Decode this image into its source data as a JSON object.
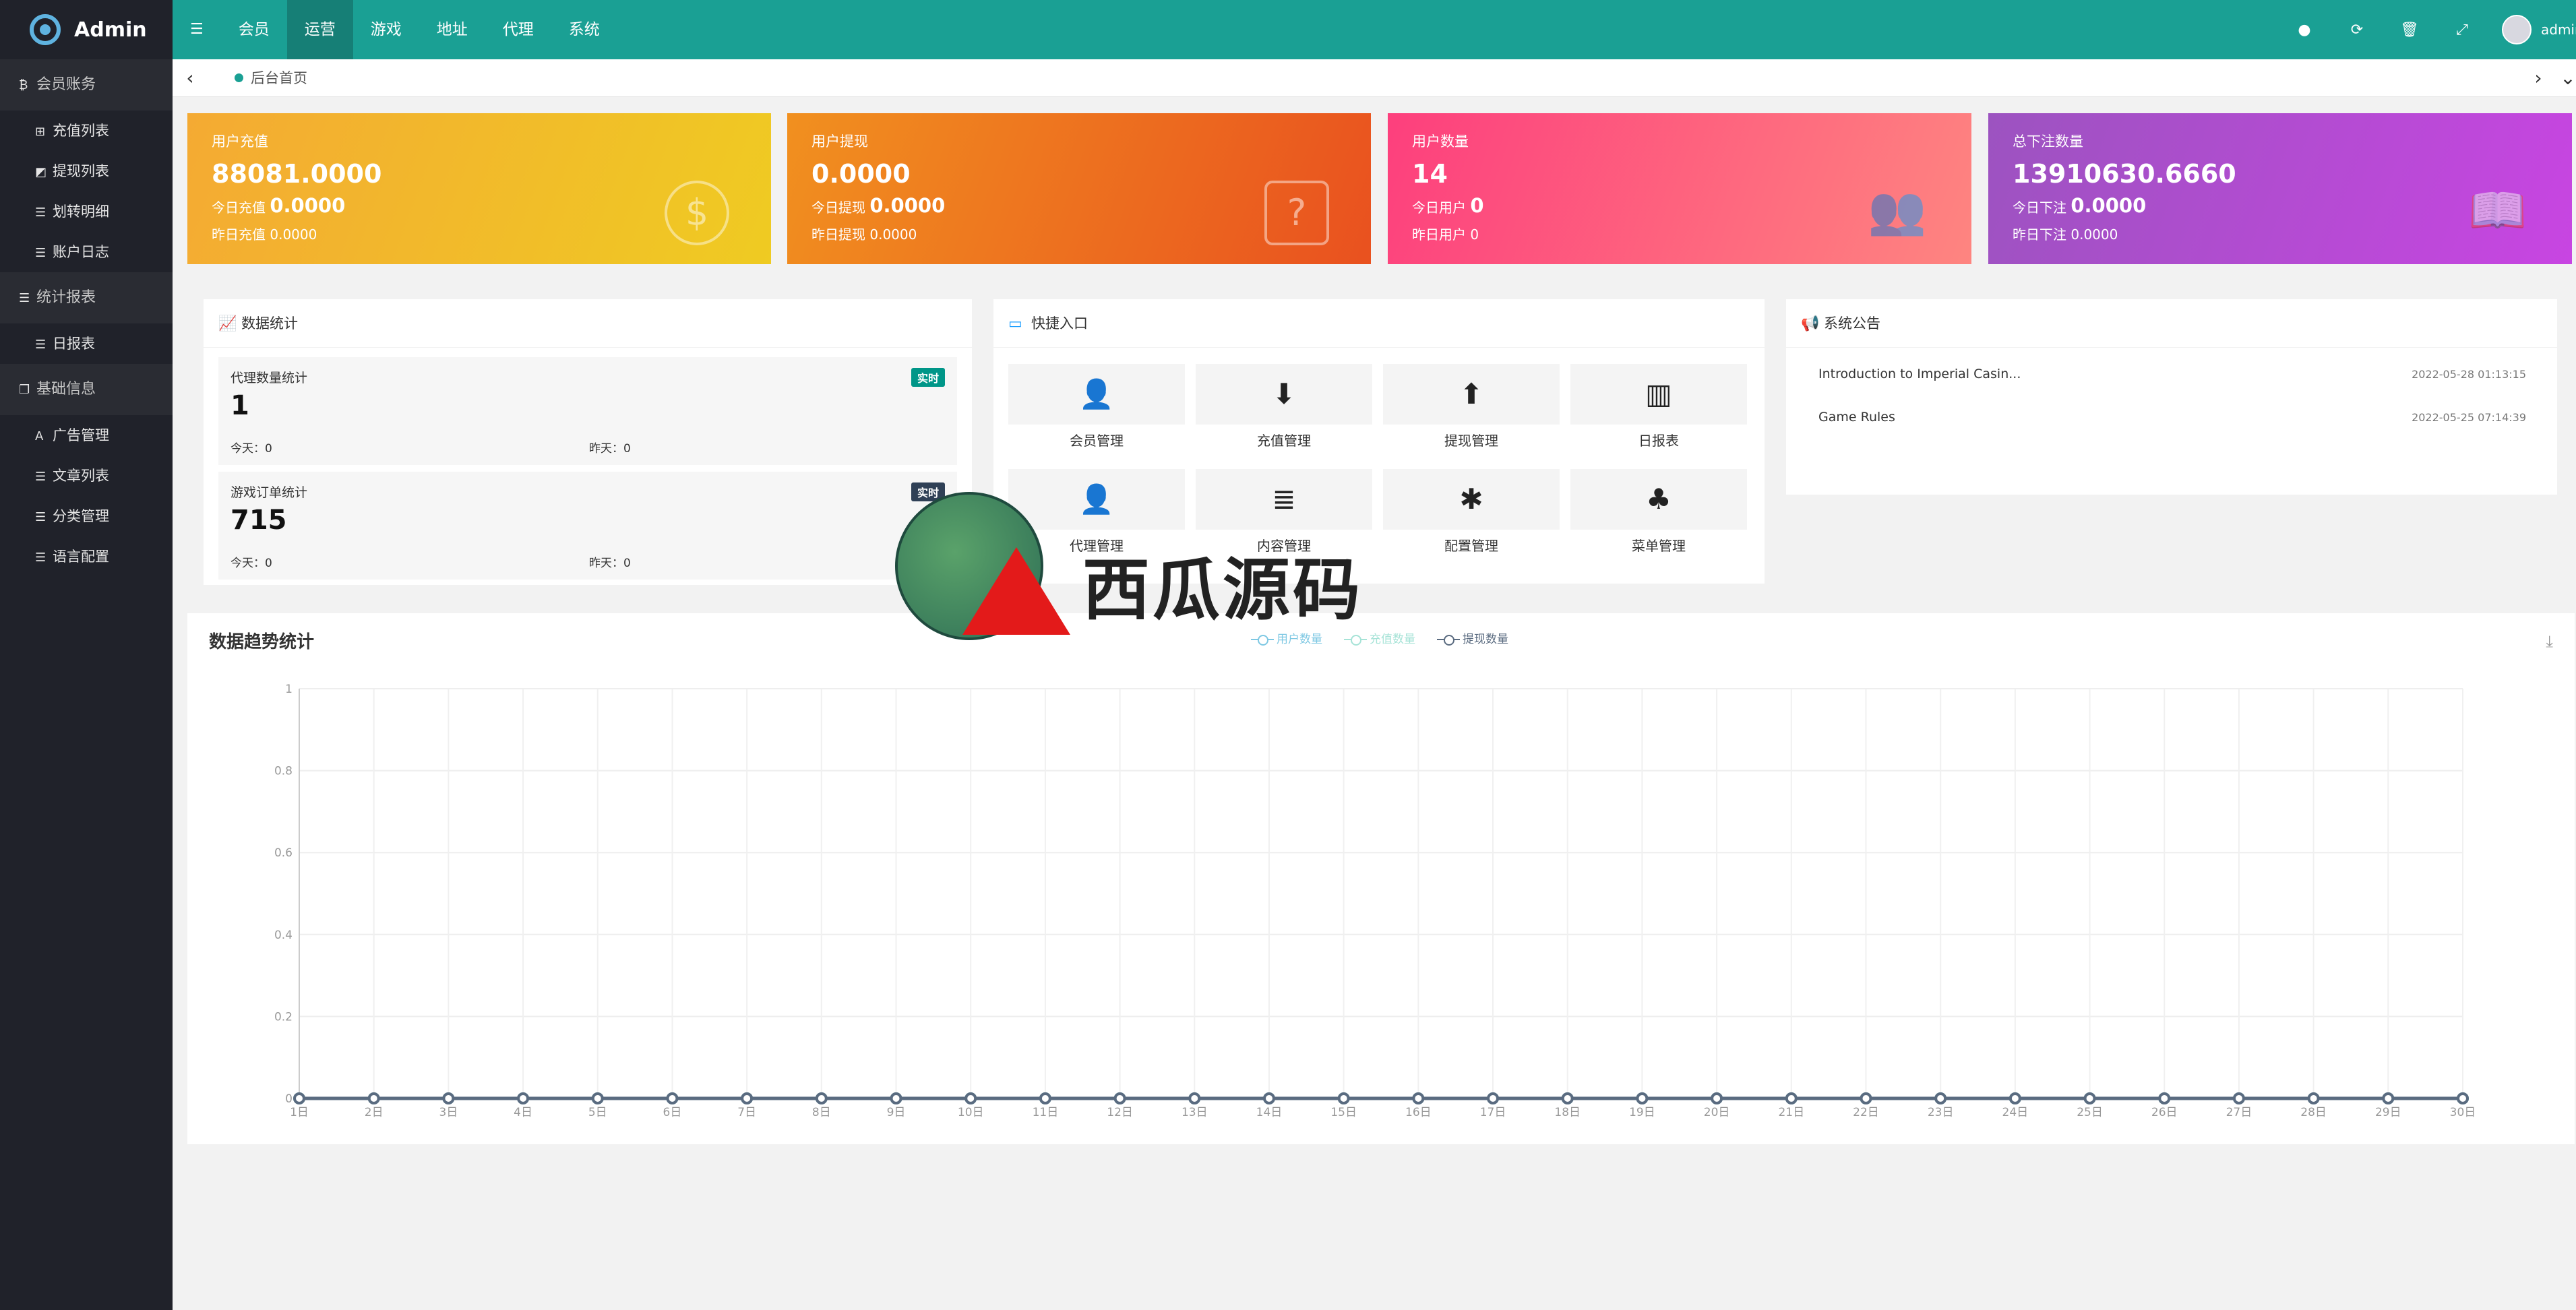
{
  "app": {
    "logo_text": "Admin"
  },
  "top_menu": [
    {
      "icon": "menu-icon",
      "label": "☰"
    },
    {
      "label": "会员"
    },
    {
      "label": "运营",
      "active": true
    },
    {
      "label": "游戏"
    },
    {
      "label": "地址"
    },
    {
      "label": "代理"
    },
    {
      "label": "系统"
    }
  ],
  "top_right": {
    "icons": [
      "settings-icon",
      "refresh-icon",
      "trash-icon",
      "fullscreen-icon"
    ],
    "user": "admin"
  },
  "sidebar": {
    "groups": [
      {
        "label": "会员账务",
        "icon": "bitcoin-icon",
        "items": [
          "充值列表",
          "提现列表",
          "划转明细",
          "账户日志"
        ]
      },
      {
        "label": "统计报表",
        "icon": "list-icon",
        "items": [
          "日报表"
        ]
      },
      {
        "label": "基础信息",
        "icon": "copy-icon",
        "items": [
          "广告管理",
          "文章列表",
          "分类管理",
          "语言配置"
        ]
      }
    ]
  },
  "tabbar": {
    "current_tab": "后台首页",
    "prev": "‹",
    "next": "›",
    "more": "⌄"
  },
  "cards": [
    {
      "title": "用户充值",
      "value": "88081.0000",
      "today_label": "今日充值",
      "today_value": "0.0000",
      "yesterday": "昨日充值 0.0000",
      "icon": "dollar-icon",
      "glyph": "$"
    },
    {
      "title": "用户提现",
      "value": "0.0000",
      "today_label": "今日提现",
      "today_value": "0.0000",
      "yesterday": "昨日提现 0.0000",
      "icon": "question-edit-icon",
      "glyph": "?"
    },
    {
      "title": "用户数量",
      "value": "14",
      "today_label": "今日用户",
      "today_value": "0",
      "yesterday": "昨日用户 0",
      "icon": "users-icon",
      "glyph": "👥"
    },
    {
      "title": "总下注数量",
      "value": "13910630.6660",
      "today_label": "今日下注",
      "today_value": "0.0000",
      "yesterday": "昨日下注 0.0000",
      "icon": "book-icon",
      "glyph": "📖"
    }
  ],
  "data_stats": {
    "title": "数据统计",
    "items": [
      {
        "label": "代理数量统计",
        "value": "1",
        "today": "今天：0",
        "yesterday": "昨天：0",
        "badge": "实时",
        "badge_color": "#009688"
      },
      {
        "label": "游戏订单统计",
        "value": "715",
        "today": "今天：0",
        "yesterday": "昨天：0",
        "badge": "实时",
        "badge_color": "#2f4056"
      }
    ]
  },
  "quick_entry": {
    "title": "快捷入口",
    "items": [
      {
        "label": "会员管理",
        "icon": "user-icon",
        "glyph": "👤"
      },
      {
        "label": "充值管理",
        "icon": "arrow-down-circle-icon",
        "glyph": "⬇"
      },
      {
        "label": "提现管理",
        "icon": "arrow-up-circle-icon",
        "glyph": "⬆"
      },
      {
        "label": "日报表",
        "icon": "bar-chart-icon",
        "glyph": "▥"
      },
      {
        "label": "代理管理",
        "icon": "user-plus-icon",
        "glyph": "👤"
      },
      {
        "label": "内容管理",
        "icon": "list-icon",
        "glyph": "≣"
      },
      {
        "label": "配置管理",
        "icon": "asterisk-icon",
        "glyph": "✱"
      },
      {
        "label": "菜单管理",
        "icon": "tree-icon",
        "glyph": "♣"
      }
    ]
  },
  "notices": {
    "title": "系统公告",
    "items": [
      {
        "text": "Introduction to Imperial Casin...",
        "date": "2022-05-28 01:13:15"
      },
      {
        "text": "Game Rules",
        "date": "2022-05-25 07:14:39"
      }
    ]
  },
  "watermark": {
    "text": "西瓜源码"
  },
  "chart_data": {
    "type": "line",
    "title": "数据趋势统计",
    "categories": [
      "1日",
      "2日",
      "3日",
      "4日",
      "5日",
      "6日",
      "7日",
      "8日",
      "9日",
      "10日",
      "11日",
      "12日",
      "13日",
      "14日",
      "15日",
      "16日",
      "17日",
      "18日",
      "19日",
      "20日",
      "21日",
      "22日",
      "23日",
      "24日",
      "25日",
      "26日",
      "27日",
      "28日",
      "29日",
      "30日"
    ],
    "series": [
      {
        "name": "用户数量",
        "color": "#7ec8e3",
        "values": [
          0,
          0,
          0,
          0,
          0,
          0,
          0,
          0,
          0,
          0,
          0,
          0,
          0,
          0,
          0,
          0,
          0,
          0,
          0,
          0,
          0,
          0,
          0,
          0,
          0,
          0,
          0,
          0,
          0,
          0
        ]
      },
      {
        "name": "充值数量",
        "color": "#a6e3d7",
        "values": [
          0,
          0,
          0,
          0,
          0,
          0,
          0,
          0,
          0,
          0,
          0,
          0,
          0,
          0,
          0,
          0,
          0,
          0,
          0,
          0,
          0,
          0,
          0,
          0,
          0,
          0,
          0,
          0,
          0,
          0
        ]
      },
      {
        "name": "提现数量",
        "color": "#5a6b80",
        "values": [
          0,
          0,
          0,
          0,
          0,
          0,
          0,
          0,
          0,
          0,
          0,
          0,
          0,
          0,
          0,
          0,
          0,
          0,
          0,
          0,
          0,
          0,
          0,
          0,
          0,
          0,
          0,
          0,
          0,
          0
        ]
      }
    ],
    "yticks": [
      "0",
      "0.2",
      "0.4",
      "0.6",
      "0.8",
      "1"
    ],
    "ylim": [
      0,
      1
    ],
    "grid": true,
    "legend_position": "top-center"
  }
}
